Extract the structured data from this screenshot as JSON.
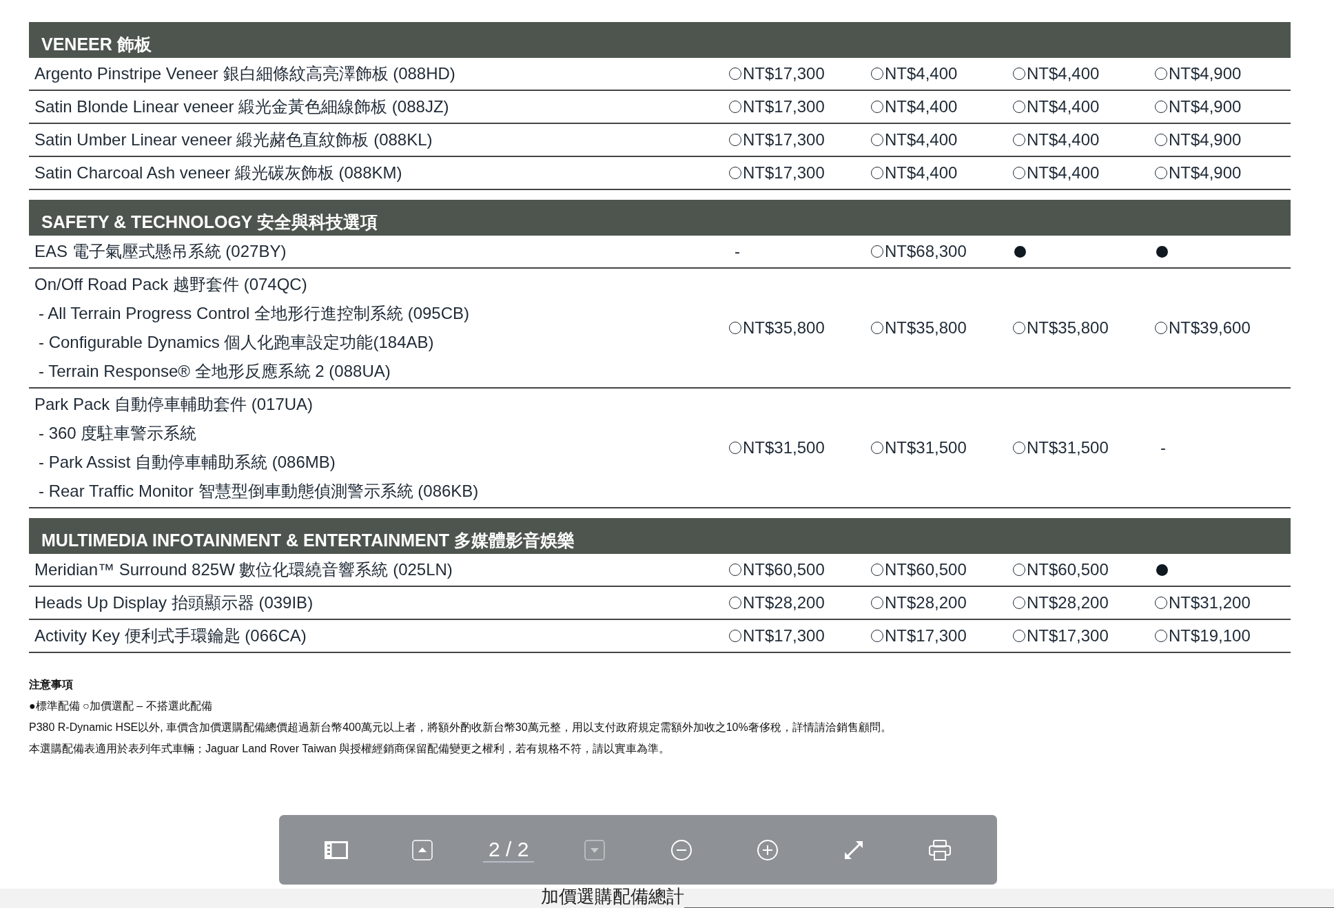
{
  "sections": [
    {
      "title": "VENEER 飾板",
      "rows": [
        {
          "lines": [
            {
              "kind": "main",
              "text": "Argento Pinstripe Veneer 銀白細條紋高亮澤飾板 (088HD)"
            }
          ],
          "cells": [
            {
              "kind": "option",
              "price": "NT$17,300"
            },
            {
              "kind": "option",
              "price": "NT$4,400"
            },
            {
              "kind": "option",
              "price": "NT$4,400"
            },
            {
              "kind": "option",
              "price": "NT$4,900"
            }
          ]
        },
        {
          "lines": [
            {
              "kind": "main",
              "text": "Satin Blonde Linear veneer 緞光金黃色細線飾板 (088JZ)"
            }
          ],
          "cells": [
            {
              "kind": "option",
              "price": "NT$17,300"
            },
            {
              "kind": "option",
              "price": "NT$4,400"
            },
            {
              "kind": "option",
              "price": "NT$4,400"
            },
            {
              "kind": "option",
              "price": "NT$4,900"
            }
          ]
        },
        {
          "lines": [
            {
              "kind": "main",
              "text": "Satin Umber Linear veneer 緞光赭色直紋飾板 (088KL)"
            }
          ],
          "cells": [
            {
              "kind": "option",
              "price": "NT$17,300"
            },
            {
              "kind": "option",
              "price": "NT$4,400"
            },
            {
              "kind": "option",
              "price": "NT$4,400"
            },
            {
              "kind": "option",
              "price": "NT$4,900"
            }
          ]
        },
        {
          "lines": [
            {
              "kind": "main",
              "text": "Satin Charcoal Ash veneer 緞光碳灰飾板 (088KM)"
            }
          ],
          "cells": [
            {
              "kind": "option",
              "price": "NT$17,300"
            },
            {
              "kind": "option",
              "price": "NT$4,400"
            },
            {
              "kind": "option",
              "price": "NT$4,400"
            },
            {
              "kind": "option",
              "price": "NT$4,900"
            }
          ]
        }
      ]
    },
    {
      "title": "SAFETY & TECHNOLOGY 安全與科技選項",
      "rows": [
        {
          "lines": [
            {
              "kind": "main",
              "text": "EAS 電子氣壓式懸吊系統 (027BY)"
            }
          ],
          "cells": [
            {
              "kind": "none",
              "text": "-"
            },
            {
              "kind": "option",
              "price": "NT$68,300"
            },
            {
              "kind": "standard"
            },
            {
              "kind": "standard"
            }
          ]
        },
        {
          "lines": [
            {
              "kind": "main",
              "text": "On/Off Road Pack 越野套件 (074QC)"
            },
            {
              "kind": "sub",
              "text": "- All Terrain Progress Control 全地形行進控制系統 (095CB)"
            },
            {
              "kind": "sub",
              "text": "- Configurable Dynamics 個人化跑車設定功能(184AB)"
            },
            {
              "kind": "sub",
              "text": "- Terrain Response® 全地形反應系統 2 (088UA)"
            }
          ],
          "cells": [
            {
              "kind": "option",
              "price": "NT$35,800"
            },
            {
              "kind": "option",
              "price": "NT$35,800"
            },
            {
              "kind": "option",
              "price": "NT$35,800"
            },
            {
              "kind": "option",
              "price": "NT$39,600"
            }
          ]
        },
        {
          "lines": [
            {
              "kind": "main",
              "text": "Park Pack 自動停車輔助套件 (017UA)"
            },
            {
              "kind": "sub",
              "text": "- 360 度駐車警示系統"
            },
            {
              "kind": "sub",
              "text": "- Park Assist 自動停車輔助系統 (086MB)"
            },
            {
              "kind": "sub",
              "text": "- Rear Traffic Monitor 智慧型倒車動態偵測警示系統 (086KB)"
            }
          ],
          "cells": [
            {
              "kind": "option",
              "price": "NT$31,500"
            },
            {
              "kind": "option",
              "price": "NT$31,500"
            },
            {
              "kind": "option",
              "price": "NT$31,500"
            },
            {
              "kind": "none",
              "text": "-"
            }
          ]
        }
      ]
    },
    {
      "title": "MULTIMEDIA INFOTAINMENT & ENTERTAINMENT 多媒體影音娛樂",
      "rows": [
        {
          "lines": [
            {
              "kind": "main",
              "text": "Meridian™ Surround  825W 數位化環繞音響系統 (025LN)"
            }
          ],
          "cells": [
            {
              "kind": "option",
              "price": "NT$60,500"
            },
            {
              "kind": "option",
              "price": "NT$60,500"
            },
            {
              "kind": "option",
              "price": "NT$60,500"
            },
            {
              "kind": "standard"
            }
          ]
        },
        {
          "lines": [
            {
              "kind": "main",
              "text": "Heads Up Display 抬頭顯示器 (039IB)"
            }
          ],
          "cells": [
            {
              "kind": "option",
              "price": "NT$28,200"
            },
            {
              "kind": "option",
              "price": "NT$28,200"
            },
            {
              "kind": "option",
              "price": "NT$28,200"
            },
            {
              "kind": "option",
              "price": "NT$31,200"
            }
          ]
        },
        {
          "lines": [
            {
              "kind": "main",
              "text": "Activity Key 便利式手環鑰匙 (066CA)"
            }
          ],
          "cells": [
            {
              "kind": "option",
              "price": "NT$17,300"
            },
            {
              "kind": "option",
              "price": "NT$17,300"
            },
            {
              "kind": "option",
              "price": "NT$17,300"
            },
            {
              "kind": "option",
              "price": "NT$19,100"
            }
          ]
        }
      ]
    }
  ],
  "notes": {
    "heading": "注意事項",
    "lines": [
      "●標準配備 ○加價選配 – 不搭選此配備",
      "P380 R-Dynamic HSE以外, 車價含加價選購配備總價超過新台幣400萬元以上者，將額外酌收新台幣30萬元整，用以支付政府規定需額外加收之10%奢侈稅，詳情請洽銷售顧問。",
      "本選購配備表適用於表列年式車輛；Jaguar Land Rover Taiwan 與授權經銷商保留配備變更之權利，若有規格不符，請以實車為準。"
    ]
  },
  "total": {
    "label": "加價選購配備總計"
  },
  "toolbar": {
    "buttons": [
      {
        "kind": "sidebar",
        "disabled": false
      },
      {
        "kind": "prev",
        "disabled": false
      },
      {
        "kind": "page",
        "value": "2 / 2"
      },
      {
        "kind": "next",
        "disabled": true
      },
      {
        "kind": "zoom-out",
        "disabled": false
      },
      {
        "kind": "zoom-in",
        "disabled": false
      },
      {
        "kind": "fullscreen",
        "disabled": false
      },
      {
        "kind": "print",
        "disabled": false
      }
    ]
  }
}
